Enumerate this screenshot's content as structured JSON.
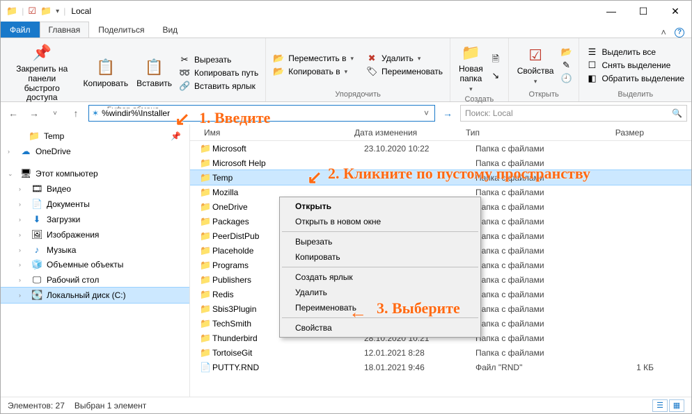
{
  "window": {
    "title": "Local"
  },
  "tabs": {
    "file": "Файл",
    "home": "Главная",
    "share": "Поделиться",
    "view": "Вид"
  },
  "ribbon": {
    "g1": {
      "pin": "Закрепить на панели\nбыстрого доступа",
      "copy": "Копировать",
      "paste": "Вставить",
      "cut": "Вырезать",
      "copypath": "Копировать путь",
      "pastelnk": "Вставить ярлык",
      "title": "Буфер обмена"
    },
    "g2": {
      "moveto": "Переместить в",
      "copyto": "Копировать в",
      "delete": "Удалить",
      "rename": "Переименовать",
      "title": "Упорядочить"
    },
    "g3": {
      "newfolder": "Новая\nпапка",
      "title": "Создать"
    },
    "g4": {
      "props": "Свойства",
      "title": "Открыть"
    },
    "g5": {
      "selall": "Выделить все",
      "selnone": "Снять выделение",
      "selinv": "Обратить выделение",
      "title": "Выделить"
    }
  },
  "address": {
    "path": "%windir%\\Installer"
  },
  "search": {
    "placeholder": "Поиск: Local"
  },
  "tree": {
    "temp": "Temp",
    "onedrive": "OneDrive",
    "thispc": "Этот компьютер",
    "videos": "Видео",
    "documents": "Документы",
    "downloads": "Загрузки",
    "pictures": "Изображения",
    "music": "Музыка",
    "objects3d": "Объемные объекты",
    "desktop": "Рабочий стол",
    "diskc": "Локальный диск (C:)"
  },
  "columns": {
    "name": "Имя",
    "date": "Дата изменения",
    "type": "Тип",
    "size": "Размер"
  },
  "folder_type": "Папка с файлами",
  "file_rnd_type": "Файл \"RND\"",
  "files": [
    {
      "name": "Microsoft",
      "date": "23.10.2020 10:22",
      "kind": "folder"
    },
    {
      "name": "Microsoft Help",
      "date": "",
      "kind": "folder"
    },
    {
      "name": "Temp",
      "date": "",
      "kind": "folder",
      "selected": true
    },
    {
      "name": "Mozilla",
      "date": "",
      "kind": "folder",
      "clip": true
    },
    {
      "name": "OneDrive",
      "date": "",
      "kind": "folder",
      "clip": true
    },
    {
      "name": "Packages",
      "date": "",
      "kind": "folder",
      "clip": true
    },
    {
      "name": "PeerDistPub",
      "date": "",
      "kind": "folder",
      "clip": true
    },
    {
      "name": "Placeholde",
      "date": "",
      "kind": "folder",
      "clip": true
    },
    {
      "name": "Programs",
      "date": "",
      "kind": "folder",
      "clip": true
    },
    {
      "name": "Publishers",
      "date": "",
      "kind": "folder",
      "clip": true
    },
    {
      "name": "Redis",
      "date": "",
      "kind": "folder",
      "clip": true
    },
    {
      "name": "Sbis3Plugin",
      "date": "",
      "kind": "folder",
      "clip": true
    },
    {
      "name": "TechSmith",
      "date": "",
      "kind": "folder",
      "clip": true
    },
    {
      "name": "Thunderbird",
      "date": "28.10.2020 10:21",
      "kind": "folder"
    },
    {
      "name": "TortoiseGit",
      "date": "12.01.2021 8:28",
      "kind": "folder"
    },
    {
      "name": "PUTTY.RND",
      "date": "18.01.2021 9:46",
      "kind": "file",
      "size": "1 КБ"
    }
  ],
  "context": {
    "open": "Открыть",
    "opennew": "Открыть в новом окне",
    "cut": "Вырезать",
    "copy": "Копировать",
    "shortcut": "Создать ярлык",
    "delete": "Удалить",
    "rename": "Переименовать",
    "props": "Свойства"
  },
  "status": {
    "count": "Элементов: 27",
    "selection": "Выбран 1 элемент"
  },
  "annotations": {
    "a1": "1. Введите",
    "a2": "2. Кликните по пустому пространству",
    "a3": "3. Выберите"
  }
}
